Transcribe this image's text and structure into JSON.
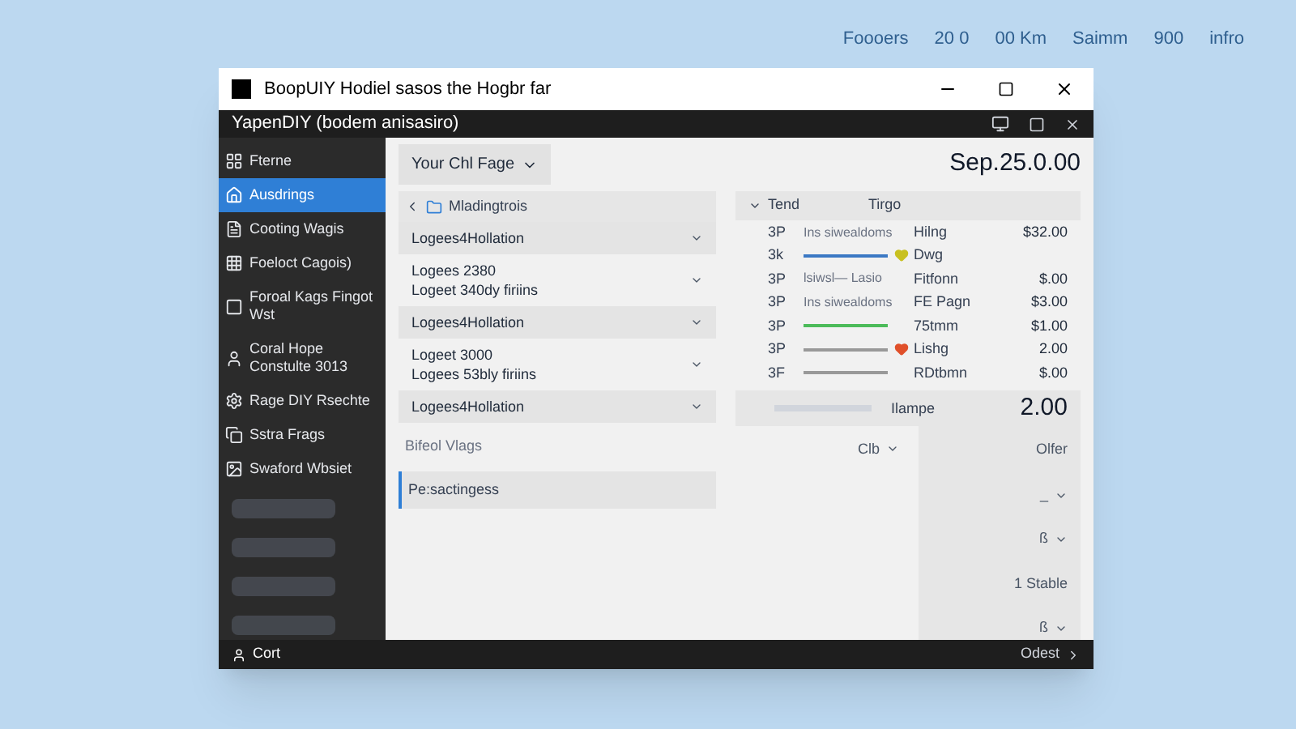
{
  "backdrop": {
    "labels": [
      "Foooers",
      "20 0",
      "00 Km",
      "Saimm",
      "900",
      "infro"
    ]
  },
  "window": {
    "title": "BoopUIY Hodiel sasos the Hogbr far"
  },
  "app_bar": {
    "title": "YapenDIY (bodem anisasiro)"
  },
  "sidebar": {
    "items": [
      {
        "label": "Fterne",
        "selected": false
      },
      {
        "label": "Ausdrings",
        "selected": true
      },
      {
        "label": "Cooting Wagis",
        "selected": false
      },
      {
        "label": "Foeloct Cagois)",
        "selected": false
      },
      {
        "label": "Foroal Kags Fingot Wst",
        "selected": false
      },
      {
        "label": "Coral Hope Constulte 3013",
        "selected": false
      },
      {
        "label": "Rage DIY Rsechte",
        "selected": false
      },
      {
        "label": "Sstra Frags",
        "selected": false
      },
      {
        "label": "Swaford Wbsiet",
        "selected": false
      }
    ]
  },
  "view_dropdown": {
    "value": "Your Chl Fage"
  },
  "date": "Sep.25.0.00",
  "list": {
    "header": "Mladingtrois",
    "rows": [
      {
        "lines": [
          "Logees4Hollation"
        ]
      },
      {
        "lines": [
          "Logees 2380",
          "Logeet 340dy firiins"
        ]
      },
      {
        "lines": [
          "Logees4Hollation"
        ]
      },
      {
        "lines": [
          "Logeet 3000",
          "Logees 53bly firiins"
        ]
      },
      {
        "lines": [
          "Logees4Hollation"
        ]
      }
    ],
    "section": "Bifeol Vlags",
    "selected_item": "Pe:sactingess"
  },
  "table": {
    "columns": [
      "Tend",
      "Tirgo"
    ],
    "rows": [
      {
        "num": "3P",
        "kind": "text",
        "detail": "Ins siwealdoms",
        "label": "Hilng",
        "amount": "$32.00"
      },
      {
        "num": "3k",
        "kind": "line",
        "color": "#3b78c4",
        "heart": {
          "color": "#c8c020"
        },
        "label": "Dwg"
      },
      {
        "num": "3P",
        "kind": "text",
        "detail": "lsiwsl— Lasio",
        "label": "Fitfonn",
        "amount": "$.00"
      },
      {
        "num": "3P",
        "kind": "text",
        "detail": "Ins siwealdoms",
        "label": "FE Pagn",
        "amount": "$3.00"
      },
      {
        "num": "3P",
        "kind": "line",
        "color": "#4cbb5a",
        "label": "75tmm",
        "amount": "$1.00"
      },
      {
        "num": "3P",
        "kind": "line",
        "color": "#999999",
        "heart": {
          "color": "#e0502a"
        },
        "label": "Lishg",
        "amount": "2.00"
      },
      {
        "num": "3F",
        "kind": "line",
        "color": "#999999",
        "label": "RDtbmn",
        "amount": "$.00"
      }
    ],
    "total": {
      "label": "Ilampe",
      "amount": "2.00"
    },
    "filter": "Clb"
  },
  "side_panel": {
    "title": "Olfer",
    "items": [
      {
        "label": "_",
        "kind": "dropdown"
      },
      {
        "label": "ß",
        "kind": "dropdown"
      },
      {
        "label": "1 Stable",
        "kind": "text"
      },
      {
        "label": "ß",
        "kind": "dropdown"
      }
    ]
  },
  "footer": {
    "left": "Cort",
    "right": "Odest"
  }
}
